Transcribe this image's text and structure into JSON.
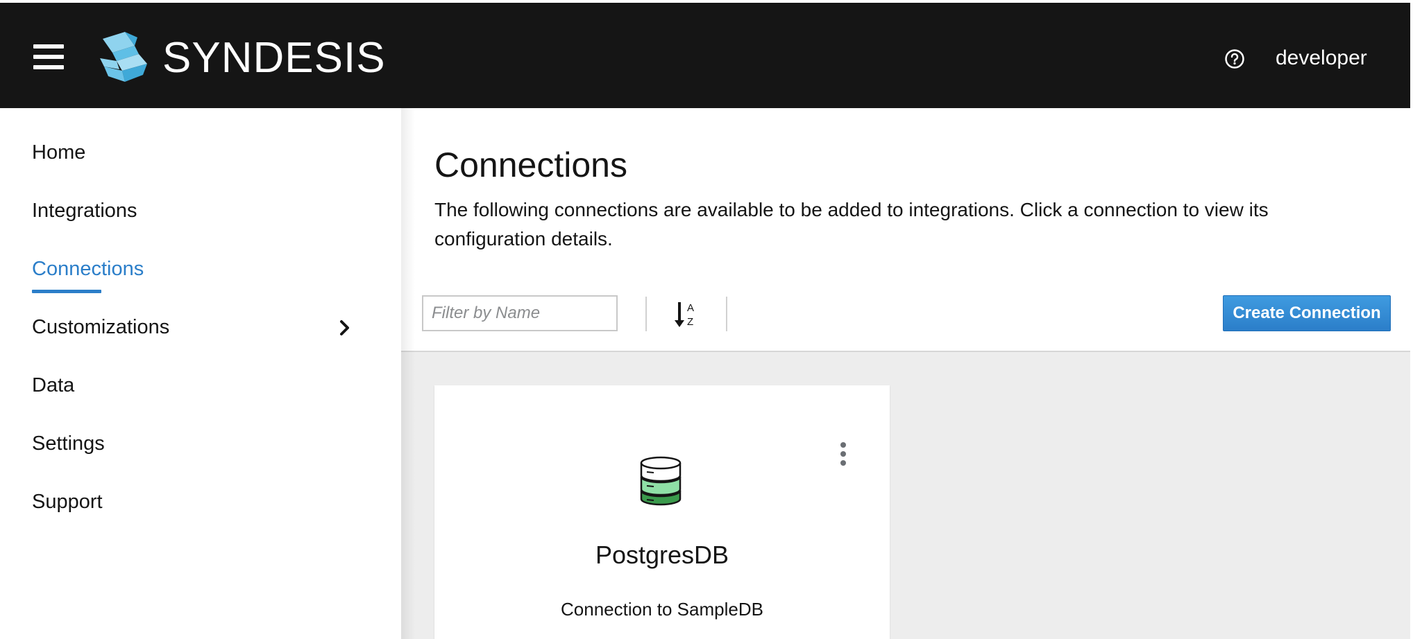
{
  "header": {
    "brand_name": "SYNDESIS",
    "user_name": "developer",
    "background_color": "#151515"
  },
  "sidebar": {
    "items": [
      {
        "label": "Home"
      },
      {
        "label": "Integrations"
      },
      {
        "label": "Connections",
        "active": true
      },
      {
        "label": "Customizations",
        "has_submenu": true
      },
      {
        "label": "Data"
      },
      {
        "label": "Settings"
      },
      {
        "label": "Support"
      }
    ],
    "active_color": "#2b7ec9"
  },
  "main": {
    "title": "Connections",
    "description": "The following connections are available to be added to integrations. Click a connection to view its configuration details.",
    "toolbar": {
      "filter_placeholder": "Filter by Name",
      "filter_value": "",
      "create_button_label": "Create Connection",
      "sort_icon": "sort-alpha-asc-icon"
    },
    "connections": [
      {
        "name": "PostgresDB",
        "description": "Connection to SampleDB",
        "icon": "database-icon"
      }
    ]
  }
}
